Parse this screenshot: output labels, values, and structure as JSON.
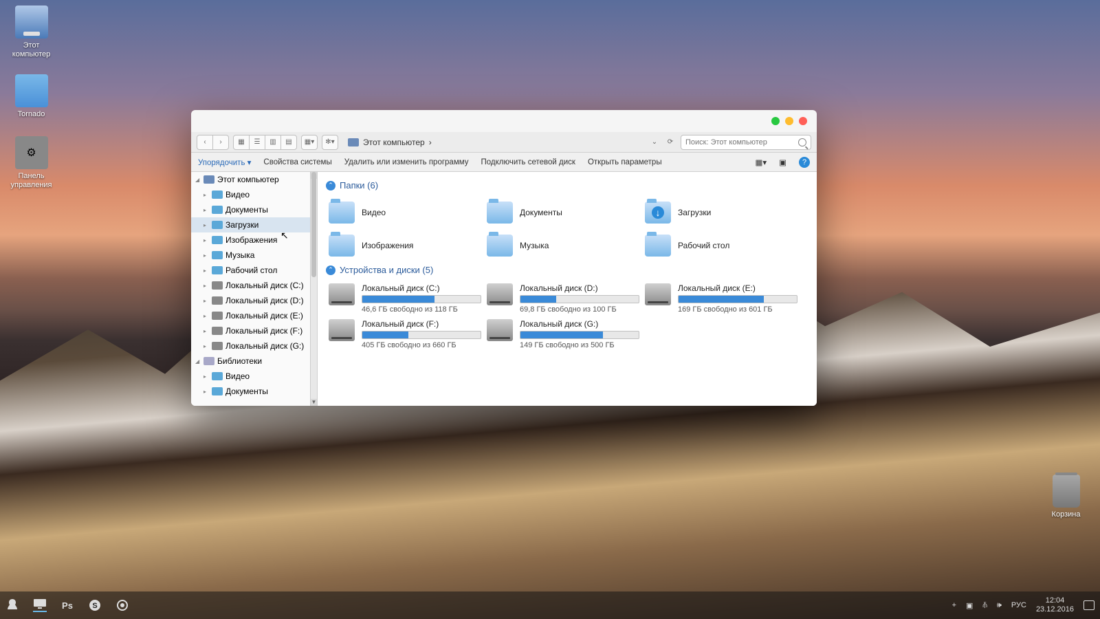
{
  "desktop_icons": [
    {
      "name": "this-pc",
      "label": "Этот\nкомпьютер"
    },
    {
      "name": "tornado",
      "label": "Tornado"
    },
    {
      "name": "control-panel",
      "label": "Панель\nуправления"
    },
    {
      "name": "recycle-bin",
      "label": "Корзина"
    }
  ],
  "traffic": {
    "green": "#28c840",
    "yellow": "#febc2e",
    "red": "#ff5f57"
  },
  "breadcrumb": {
    "location": "Этот компьютер",
    "sep": "›"
  },
  "search": {
    "placeholder": "Поиск: Этот компьютер"
  },
  "commandbar": {
    "organize": "Упорядочить ▾",
    "items": [
      "Свойства системы",
      "Удалить или изменить программу",
      "Подключить сетевой диск",
      "Открыть параметры"
    ]
  },
  "sidebar": {
    "root": "Этот компьютер",
    "items": [
      {
        "label": "Видео",
        "t": "f"
      },
      {
        "label": "Документы",
        "t": "f"
      },
      {
        "label": "Загрузки",
        "t": "f",
        "sel": true
      },
      {
        "label": "Изображения",
        "t": "f"
      },
      {
        "label": "Музыка",
        "t": "f"
      },
      {
        "label": "Рабочий стол",
        "t": "f"
      },
      {
        "label": "Локальный диск (C:)",
        "t": "d"
      },
      {
        "label": "Локальный диск (D:)",
        "t": "d"
      },
      {
        "label": "Локальный диск (E:)",
        "t": "d"
      },
      {
        "label": "Локальный диск (F:)",
        "t": "d"
      },
      {
        "label": "Локальный диск (G:)",
        "t": "d"
      }
    ],
    "libraries": "Библиотеки",
    "lib_items": [
      {
        "label": "Видео",
        "t": "f"
      },
      {
        "label": "Документы",
        "t": "f"
      }
    ]
  },
  "groups": {
    "folders_header": "Папки (6)",
    "folders": [
      {
        "label": "Видео"
      },
      {
        "label": "Документы"
      },
      {
        "label": "Загрузки",
        "dl": true
      },
      {
        "label": "Изображения"
      },
      {
        "label": "Музыка"
      },
      {
        "label": "Рабочий стол"
      }
    ],
    "drives_header": "Устройства и диски (5)",
    "drives": [
      {
        "name": "Локальный диск (C:)",
        "free": "46,6 ГБ свободно из 118 ГБ",
        "pct": 61
      },
      {
        "name": "Локальный диск (D:)",
        "free": "69,8 ГБ свободно из 100 ГБ",
        "pct": 30
      },
      {
        "name": "Локальный диск (E:)",
        "free": "169 ГБ свободно из 601 ГБ",
        "pct": 72
      },
      {
        "name": "Локальный диск (F:)",
        "free": "405 ГБ свободно из 660 ГБ",
        "pct": 39
      },
      {
        "name": "Локальный диск (G:)",
        "free": "149 ГБ свободно из 500 ГБ",
        "pct": 70
      }
    ]
  },
  "taskbar": {
    "lang": "РУС",
    "time": "12:04",
    "date": "23.12.2016"
  }
}
